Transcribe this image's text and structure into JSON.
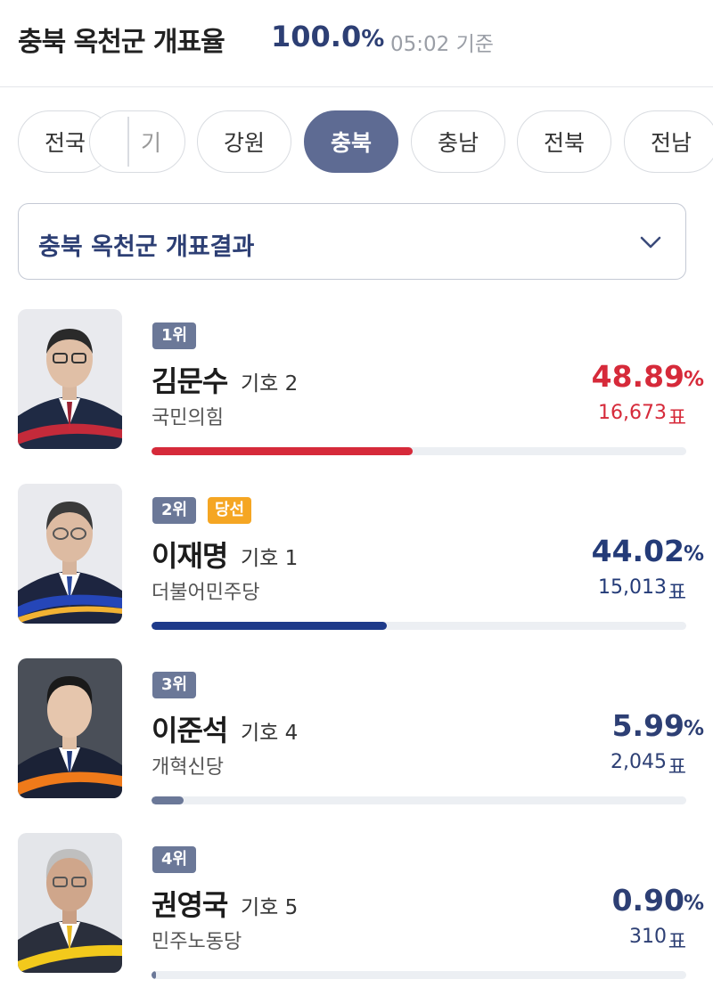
{
  "header": {
    "title": "충북 옥천군 개표율",
    "rate_value": "100.0",
    "rate_unit": "%",
    "time": "05:02 기준"
  },
  "tabs": [
    {
      "label": "전국"
    },
    {
      "label": "기"
    },
    {
      "label": "강원"
    },
    {
      "label": "충북",
      "active": true
    },
    {
      "label": "충남"
    },
    {
      "label": "전북"
    },
    {
      "label": "전남"
    }
  ],
  "dropdown": {
    "label": "충북 옥천군 개표결과",
    "icon": "chevron-down-icon"
  },
  "candidates": [
    {
      "rank": "1위",
      "elected": "",
      "name": "김문수",
      "number": "기호 2",
      "party": "국민의힘",
      "percent": "48.89",
      "percent_unit": "%",
      "votes": "16,673",
      "votes_unit": "표",
      "share": 48.89,
      "color": "#d62a3a"
    },
    {
      "rank": "2위",
      "elected": "당선",
      "name": "이재명",
      "number": "기호 1",
      "party": "더불어민주당",
      "percent": "44.02",
      "percent_unit": "%",
      "votes": "15,013",
      "votes_unit": "표",
      "share": 44.02,
      "color": "#1e3a8a"
    },
    {
      "rank": "3위",
      "elected": "",
      "name": "이준석",
      "number": "기호 4",
      "party": "개혁신당",
      "percent": "5.99",
      "percent_unit": "%",
      "votes": "2,045",
      "votes_unit": "표",
      "share": 5.99,
      "color": "#6b7898"
    },
    {
      "rank": "4위",
      "elected": "",
      "name": "권영국",
      "number": "기호 5",
      "party": "민주노동당",
      "percent": "0.90",
      "percent_unit": "%",
      "votes": "310",
      "votes_unit": "표",
      "share": 0.9,
      "color": "#6b7898"
    }
  ],
  "colors": {
    "accent": "#2d3f74",
    "active_tab": "#5e6b93",
    "elected_badge": "#f5a623"
  }
}
